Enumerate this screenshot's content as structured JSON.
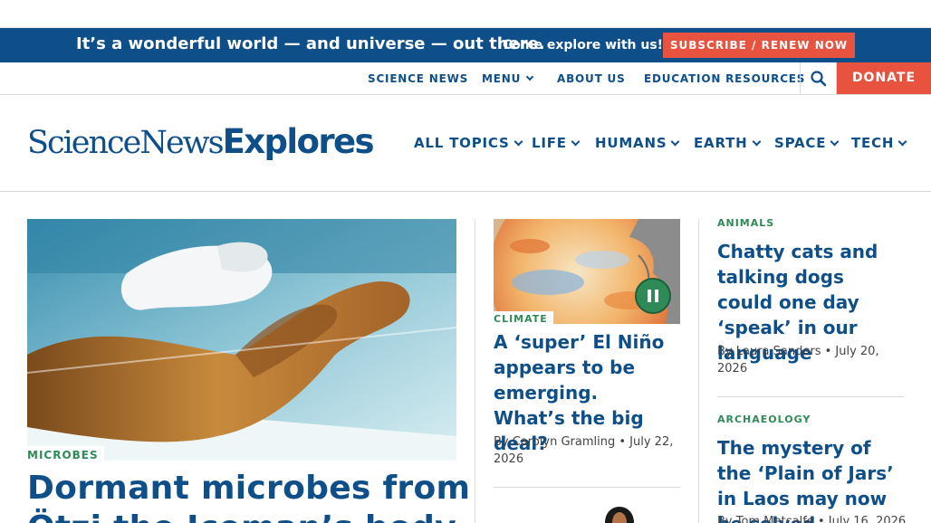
{
  "promo": {
    "headline": "It’s a wonderful world — and universe — out there.",
    "subline": "Come explore with us!",
    "cta": "SUBSCRIBE / RENEW NOW"
  },
  "utility_nav": {
    "science_news": "SCIENCE NEWS",
    "menu": "MENU",
    "about": "ABOUT US",
    "education": "EDUCATION RESOURCES",
    "donate": "DONATE"
  },
  "logo": {
    "part1": "ScienceNews",
    "part2": "Explores"
  },
  "main_nav": [
    "ALL TOPICS",
    "LIFE",
    "HUMANS",
    "EARTH",
    "SPACE",
    "TECH"
  ],
  "lead": {
    "tag": "MICROBES",
    "headline_line1": "Dormant microbes from",
    "headline_line2": "Ötzi the Iceman’s body"
  },
  "middle": {
    "tag": "CLIMATE",
    "headline": "A ‘super’ El Niño appears to be emerging. What’s the big deal?",
    "byline": "By Carolyn Gramling • July 22, 2026"
  },
  "right": [
    {
      "tag": "ANIMALS",
      "headline": "Chatty cats and talking dogs could one day ‘speak’ in our language",
      "byline": "By Laura Sanders • July 20, 2026"
    },
    {
      "tag": "ARCHAEOLOGY",
      "headline": "The mystery of the ‘Plain of Jars’ in Laos may now be solved",
      "byline": "By Tom Metcalfe • July 16, 2026"
    }
  ],
  "colors": {
    "brand_blue": "#0e4f8a",
    "accent_orange": "#e8533f",
    "tag_green": "#2e8b57"
  }
}
